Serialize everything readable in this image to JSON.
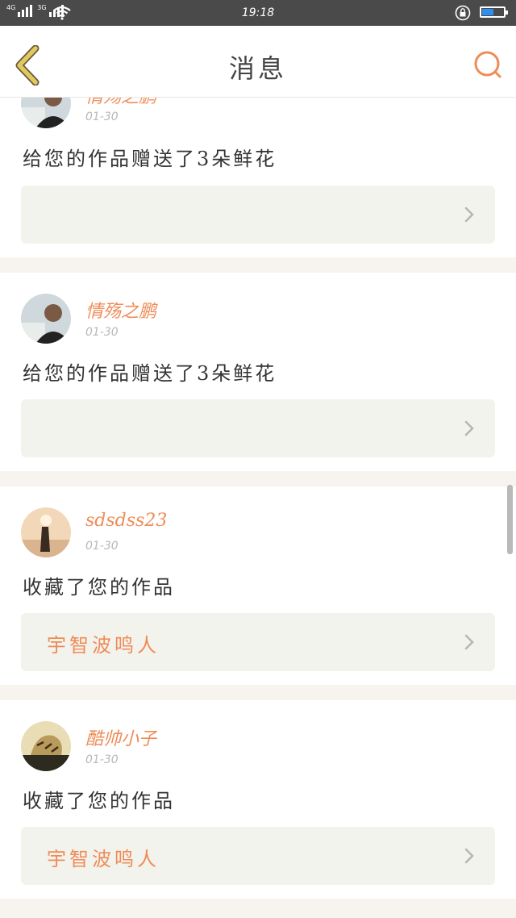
{
  "status_bar": {
    "network_1": "4G",
    "network_2": "3G",
    "time": "19:18",
    "battery_level": 0.6
  },
  "nav": {
    "title": "消息"
  },
  "messages": [
    {
      "user": "情殇之鹏",
      "date": "01-30",
      "action": "给您的作品赠送了3朵鲜花",
      "work_title": "",
      "avatar": "avatar-portrait-man-icon"
    },
    {
      "user": "情殇之鹏",
      "date": "01-30",
      "action": "给您的作品赠送了3朵鲜花",
      "work_title": "",
      "avatar": "avatar-portrait-man-icon"
    },
    {
      "user": "sdsdss23",
      "date": "01-30",
      "action": "收藏了您的作品",
      "work_title": "宇智波鸣人",
      "avatar": "avatar-girl-beach-icon"
    },
    {
      "user": "酷帅小子",
      "date": "01-30",
      "action": "收藏了您的作品",
      "work_title": "宇智波鸣人",
      "avatar": "avatar-tiger-icon"
    }
  ],
  "colors": {
    "accent": "#ef8c58",
    "back_arrow": "#e0c95e",
    "status_bar": "#4a4a4a",
    "box_bg": "#f3f3ee"
  }
}
